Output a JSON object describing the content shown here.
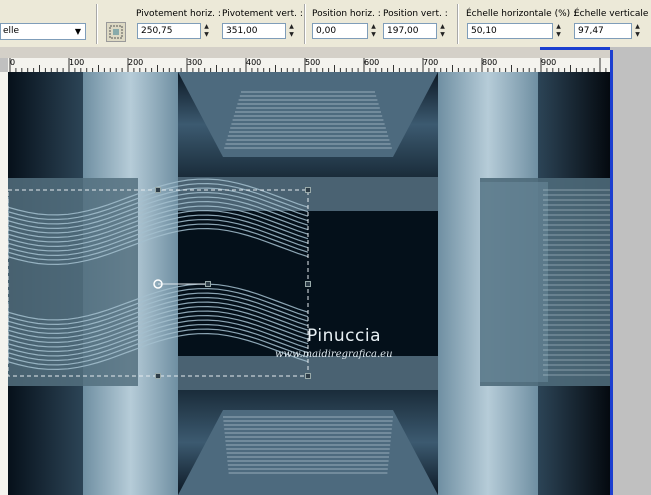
{
  "toolbar": {
    "mode_value": "elle",
    "fields": [
      {
        "label": "Pivotement horiz. :",
        "value": "250,75"
      },
      {
        "label": "Pivotement vert. :",
        "value": "351,00"
      },
      {
        "label": "Position horiz. :",
        "value": "0,00"
      },
      {
        "label": "Position vert. :",
        "value": "197,00"
      },
      {
        "label": "Échelle horizontale (%) :",
        "value": "50,10"
      },
      {
        "label": "Échelle verticale (%",
        "value": "97,47"
      }
    ]
  },
  "ruler": {
    "ticks": [
      "0",
      "100",
      "200",
      "300",
      "400",
      "500",
      "600",
      "700",
      "800",
      "900"
    ]
  },
  "watermark": {
    "name": "Pinuccia",
    "url": "www.maidiregrafica.eu"
  },
  "colors": {
    "ui_bg": "#ece9d8",
    "canvas_dark": "#0a1620",
    "steel_blue": "#5f7f93",
    "light_panel": "#9bb8c8",
    "accent_blue": "#1c3fd0"
  }
}
